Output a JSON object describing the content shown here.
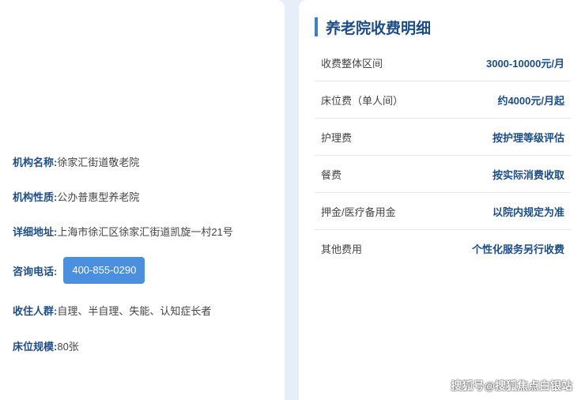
{
  "institution": {
    "name": {
      "label": "机构名称:",
      "value": "徐家汇街道敬老院"
    },
    "nature": {
      "label": "机构性质:",
      "value": "公办普惠型养老院"
    },
    "address": {
      "label": "详细地址:",
      "value": "上海市徐汇区徐家汇街道凯旋一村21号"
    },
    "phone": {
      "label": "咨询电话:",
      "value": "400-855-0290"
    },
    "residents": {
      "label": "收住人群:",
      "value": "自理、半自理、失能、认知症长者"
    },
    "beds": {
      "label": "床位规模:",
      "value": "80张"
    }
  },
  "fees": {
    "title": "养老院收费明细",
    "rows": [
      {
        "name": "收费整体区间",
        "amount": "3000-10000元/月"
      },
      {
        "name": "床位费（单人间）",
        "amount": "约4000元/月起"
      },
      {
        "name": "护理费",
        "amount": "按护理等级评估"
      },
      {
        "name": "餐费",
        "amount": "按实际消费收取"
      },
      {
        "name": "押金/医疗备用金",
        "amount": "以院内规定为准"
      },
      {
        "name": "其他费用",
        "amount": "个性化服务另行收费"
      }
    ]
  },
  "watermark": "搜狐号@搜狐焦点白银站",
  "colors": {
    "accent": "#3b7fd4",
    "label": "#1f4e87",
    "button": "#4a8fe0"
  }
}
